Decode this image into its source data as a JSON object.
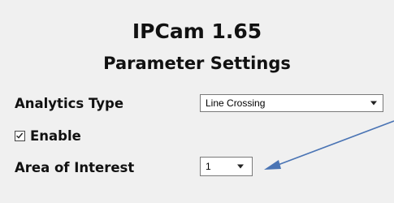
{
  "app_title": "IPCam 1.65",
  "section_title": "Parameter Settings",
  "analytics_type": {
    "label": "Analytics Type",
    "selected": "Line Crossing"
  },
  "enable": {
    "label": "Enable",
    "checked": true
  },
  "area_of_interest": {
    "label": "Area of Interest",
    "selected": "1"
  },
  "colors": {
    "background": "#f0f0f0",
    "annotation_arrow": "#4a74b4"
  },
  "icons": {
    "checkbox": "checkmark-icon",
    "dropdown": "chevron-down-icon",
    "annotation": "arrow-icon"
  }
}
